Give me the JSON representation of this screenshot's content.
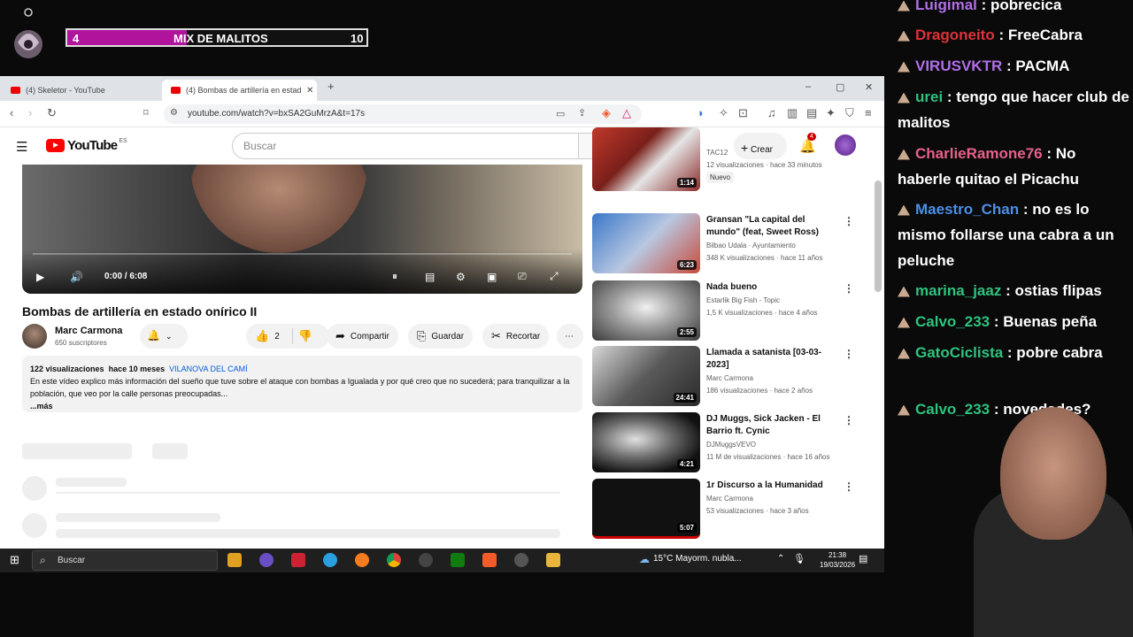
{
  "overlay": {
    "progress_current": "4",
    "progress_title": "MIX DE MALITOS",
    "progress_goal": "10",
    "progress_fraction": 0.4
  },
  "browser": {
    "tabs": [
      {
        "label": "(4) Skeletor - YouTube"
      },
      {
        "label": "(4) Bombas de artillería en estad"
      }
    ],
    "url": "youtube.com/watch?v=bxSA2GuMrzA&t=17s",
    "controls": {
      "minimize": "–",
      "restore": "▢",
      "close": "✕",
      "new_tab": "+"
    }
  },
  "youtube": {
    "logo_text": "YouTube",
    "region": "ES",
    "search_placeholder": "Buscar",
    "create_label": "Crear",
    "notifications": "4",
    "player": {
      "time": "0:00 / 6:08"
    },
    "video_title": "Bombas de artillería en estado onírico II",
    "channel": {
      "name": "Marc Carmona",
      "subscribers": "650 suscriptores"
    },
    "likes": "2",
    "actions": {
      "share": "Compartir",
      "save": "Guardar",
      "clip": "Recortar"
    },
    "description": {
      "views": "122 visualizaciones",
      "date": "hace 10 meses",
      "location": "VILANOVA DEL CAMÍ",
      "text": "En este vídeo explico más información del sueño que tuve sobre el ataque con bombas a Igualada y por qué creo que no sucederá; para tranquilizar a la población, que veo por la calle personas preocupadas...",
      "more": "...más"
    },
    "related": [
      {
        "title": "",
        "channel": "TAC12",
        "meta": "12 visualizaciones · hace 33 minutos",
        "duration": "1:14",
        "badge": "Nuevo"
      },
      {
        "title": "Gransan \"La capital del mundo\" (feat, Sweet Ross)",
        "channel": "Bilbao Udala · Ayuntamiento",
        "meta": "348 K visualizaciones · hace 11 años",
        "duration": "6:23"
      },
      {
        "title": "Nada bueno",
        "channel": "Estarlik Big Fish - Topic",
        "meta": "1,5 K visualizaciones · hace 4 años",
        "duration": "2:55"
      },
      {
        "title": "Llamada a satanista [03-03-2023]",
        "channel": "Marc Carmona",
        "meta": "186 visualizaciones · hace 2 años",
        "duration": "24:41"
      },
      {
        "title": "DJ Muggs, Sick Jacken - El Barrio ft. Cynic",
        "channel": "DJMuggsVEVO",
        "meta": "11 M de visualizaciones · hace 16 años",
        "duration": "4:21"
      },
      {
        "title": "1r Discurso a la Humanidad",
        "channel": "Marc Carmona",
        "meta": "53 visualizaciones · hace 3 años",
        "duration": "5:07"
      }
    ]
  },
  "taskbar": {
    "search": "Buscar",
    "weather": "15°C  Mayorm. nubla...",
    "time": "21:38",
    "date": "19/03/2026"
  },
  "chat": [
    {
      "user": "Luigimal",
      "text": " : pobrecica",
      "color": "#b06fe8"
    },
    {
      "user": "Dragoneito",
      "text": " : FreeCabra",
      "color": "#e0303a"
    },
    {
      "user": "VIRUSVKTR",
      "text": " : PACMA",
      "color": "#b06fe8"
    },
    {
      "user": "urei",
      "text": " : tengo que hacer club de malitos",
      "color": "#2ec27e"
    },
    {
      "user": "CharlieRamone76",
      "text": " : No haberle quitao el Picachu",
      "color": "#e8608c"
    },
    {
      "user": "Maestro_Chan",
      "text": " : no es lo mismo follarse una cabra a un peluche",
      "color": "#4b8fe8"
    },
    {
      "user": "marina_jaaz",
      "text": " : ostias flipas",
      "color": "#2ec27e"
    },
    {
      "user": "Calvo_233",
      "text": " : Buenas peña",
      "color": "#2ec27e"
    },
    {
      "user": "GatoCiclista",
      "text": " : pobre cabra",
      "color": "#2ec27e"
    },
    {
      "user": "Calvo_233",
      "text": " : novedades?",
      "color": "#2ec27e"
    }
  ],
  "colors": {
    "accent": "#b0149c",
    "yt_red": "#ff0000",
    "link": "#065fd4"
  }
}
